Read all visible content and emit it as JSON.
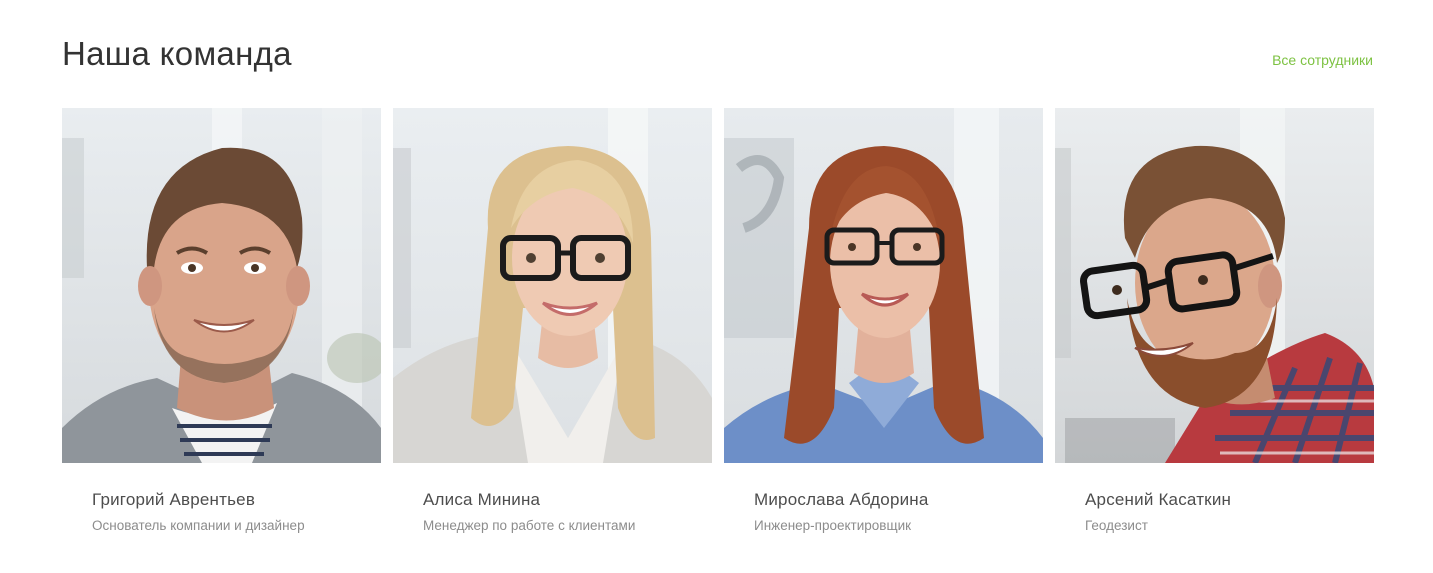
{
  "header": {
    "title": "Наша команда",
    "all_link_label": "Все сотрудники"
  },
  "theme": {
    "accent": "#7dc242"
  },
  "team": [
    {
      "name": "Григорий Аврентьев",
      "role": "Основатель компании и дизайнер"
    },
    {
      "name": "Алиса Минина",
      "role": "Менеджер по работе с клиентами"
    },
    {
      "name": "Мирослава Абдорина",
      "role": "Инженер-проектировщик"
    },
    {
      "name": "Арсений Касаткин",
      "role": "Геодезист"
    }
  ]
}
